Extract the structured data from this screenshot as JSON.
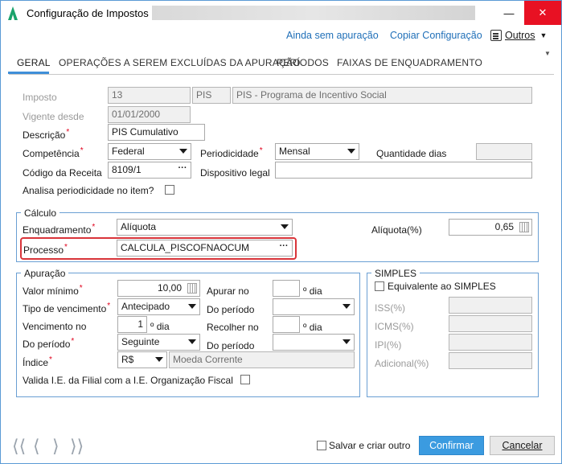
{
  "window": {
    "title": "Configuração de Impostos"
  },
  "actions": {
    "sem_apuracao": "Ainda sem apuração",
    "copiar": "Copiar Configuração",
    "outros": "Outros"
  },
  "tabs": [
    {
      "label": "GERAL"
    },
    {
      "label": "OPERAÇÕES A SEREM EXCLUÍDAS DA APURAÇÃO"
    },
    {
      "label": "PERÍODOS"
    },
    {
      "label": "FAIXAS DE ENQUADRAMENTO"
    }
  ],
  "form": {
    "imposto": {
      "label": "Imposto",
      "code": "13",
      "sigla": "PIS",
      "nome": "PIS - Programa de Incentivo Social"
    },
    "vigente": {
      "label": "Vigente desde",
      "value": "01/01/2000"
    },
    "descricao": {
      "label": "Descrição",
      "value": "PIS Cumulativo"
    },
    "competencia": {
      "label": "Competência",
      "value": "Federal"
    },
    "periodicidade": {
      "label": "Periodicidade",
      "value": "Mensal"
    },
    "quantidade_dias": {
      "label": "Quantidade dias",
      "value": ""
    },
    "codigo_receita": {
      "label": "Código da Receita",
      "value": "8109/1"
    },
    "dispositivo_legal": {
      "label": "Dispositivo legal",
      "value": ""
    },
    "analisa_periodicidade": {
      "label": "Analisa periodicidade no item?"
    }
  },
  "calculo": {
    "title": "Cálculo",
    "enquadramento": {
      "label": "Enquadramento",
      "value": "Alíquota"
    },
    "aliquota": {
      "label": "Alíquota(%)",
      "value": "0,65"
    },
    "processo": {
      "label": "Processo",
      "value": "CALCULA_PISCOFNAOCUM"
    }
  },
  "apuracao": {
    "title": "Apuração",
    "valor_minimo": {
      "label": "Valor mínimo",
      "value": "10,00"
    },
    "tipo_vencimento": {
      "label": "Tipo de vencimento",
      "value": "Antecipado"
    },
    "vencimento_no": {
      "label": "Vencimento no",
      "value": "1",
      "suffix": "º dia"
    },
    "do_periodo_1": {
      "label": "Do período",
      "value": "Seguinte"
    },
    "indice": {
      "label": "Índice",
      "code": "R$",
      "desc": "Moeda Corrente"
    },
    "apurar_no": {
      "label": "Apurar no",
      "value": "",
      "suffix": "º dia"
    },
    "do_periodo_2": {
      "label": "Do período",
      "value": ""
    },
    "recolher_no": {
      "label": "Recolher no",
      "value": "",
      "suffix": "º dia"
    },
    "do_periodo_3": {
      "label": "Do período",
      "value": ""
    },
    "valida_ie": {
      "label": "Valida I.E. da Filial com a I.E. Organização Fiscal"
    }
  },
  "simples": {
    "title": "SIMPLES",
    "equivalente": {
      "label": "Equivalente ao SIMPLES"
    },
    "iss": {
      "label": "ISS(%)",
      "value": ""
    },
    "icms": {
      "label": "ICMS(%)",
      "value": ""
    },
    "ipi": {
      "label": "IPI(%)",
      "value": ""
    },
    "adicional": {
      "label": "Adicional(%)",
      "value": ""
    }
  },
  "footer": {
    "salvar_criar": "Salvar e criar outro",
    "confirmar": "Confirmar",
    "cancelar": "Cancelar"
  },
  "colors": {
    "accent": "#3b9be0",
    "link": "#1f6fb8",
    "group_border": "#6a9fd3",
    "highlight": "#d9343a",
    "required": "#e0001b"
  }
}
